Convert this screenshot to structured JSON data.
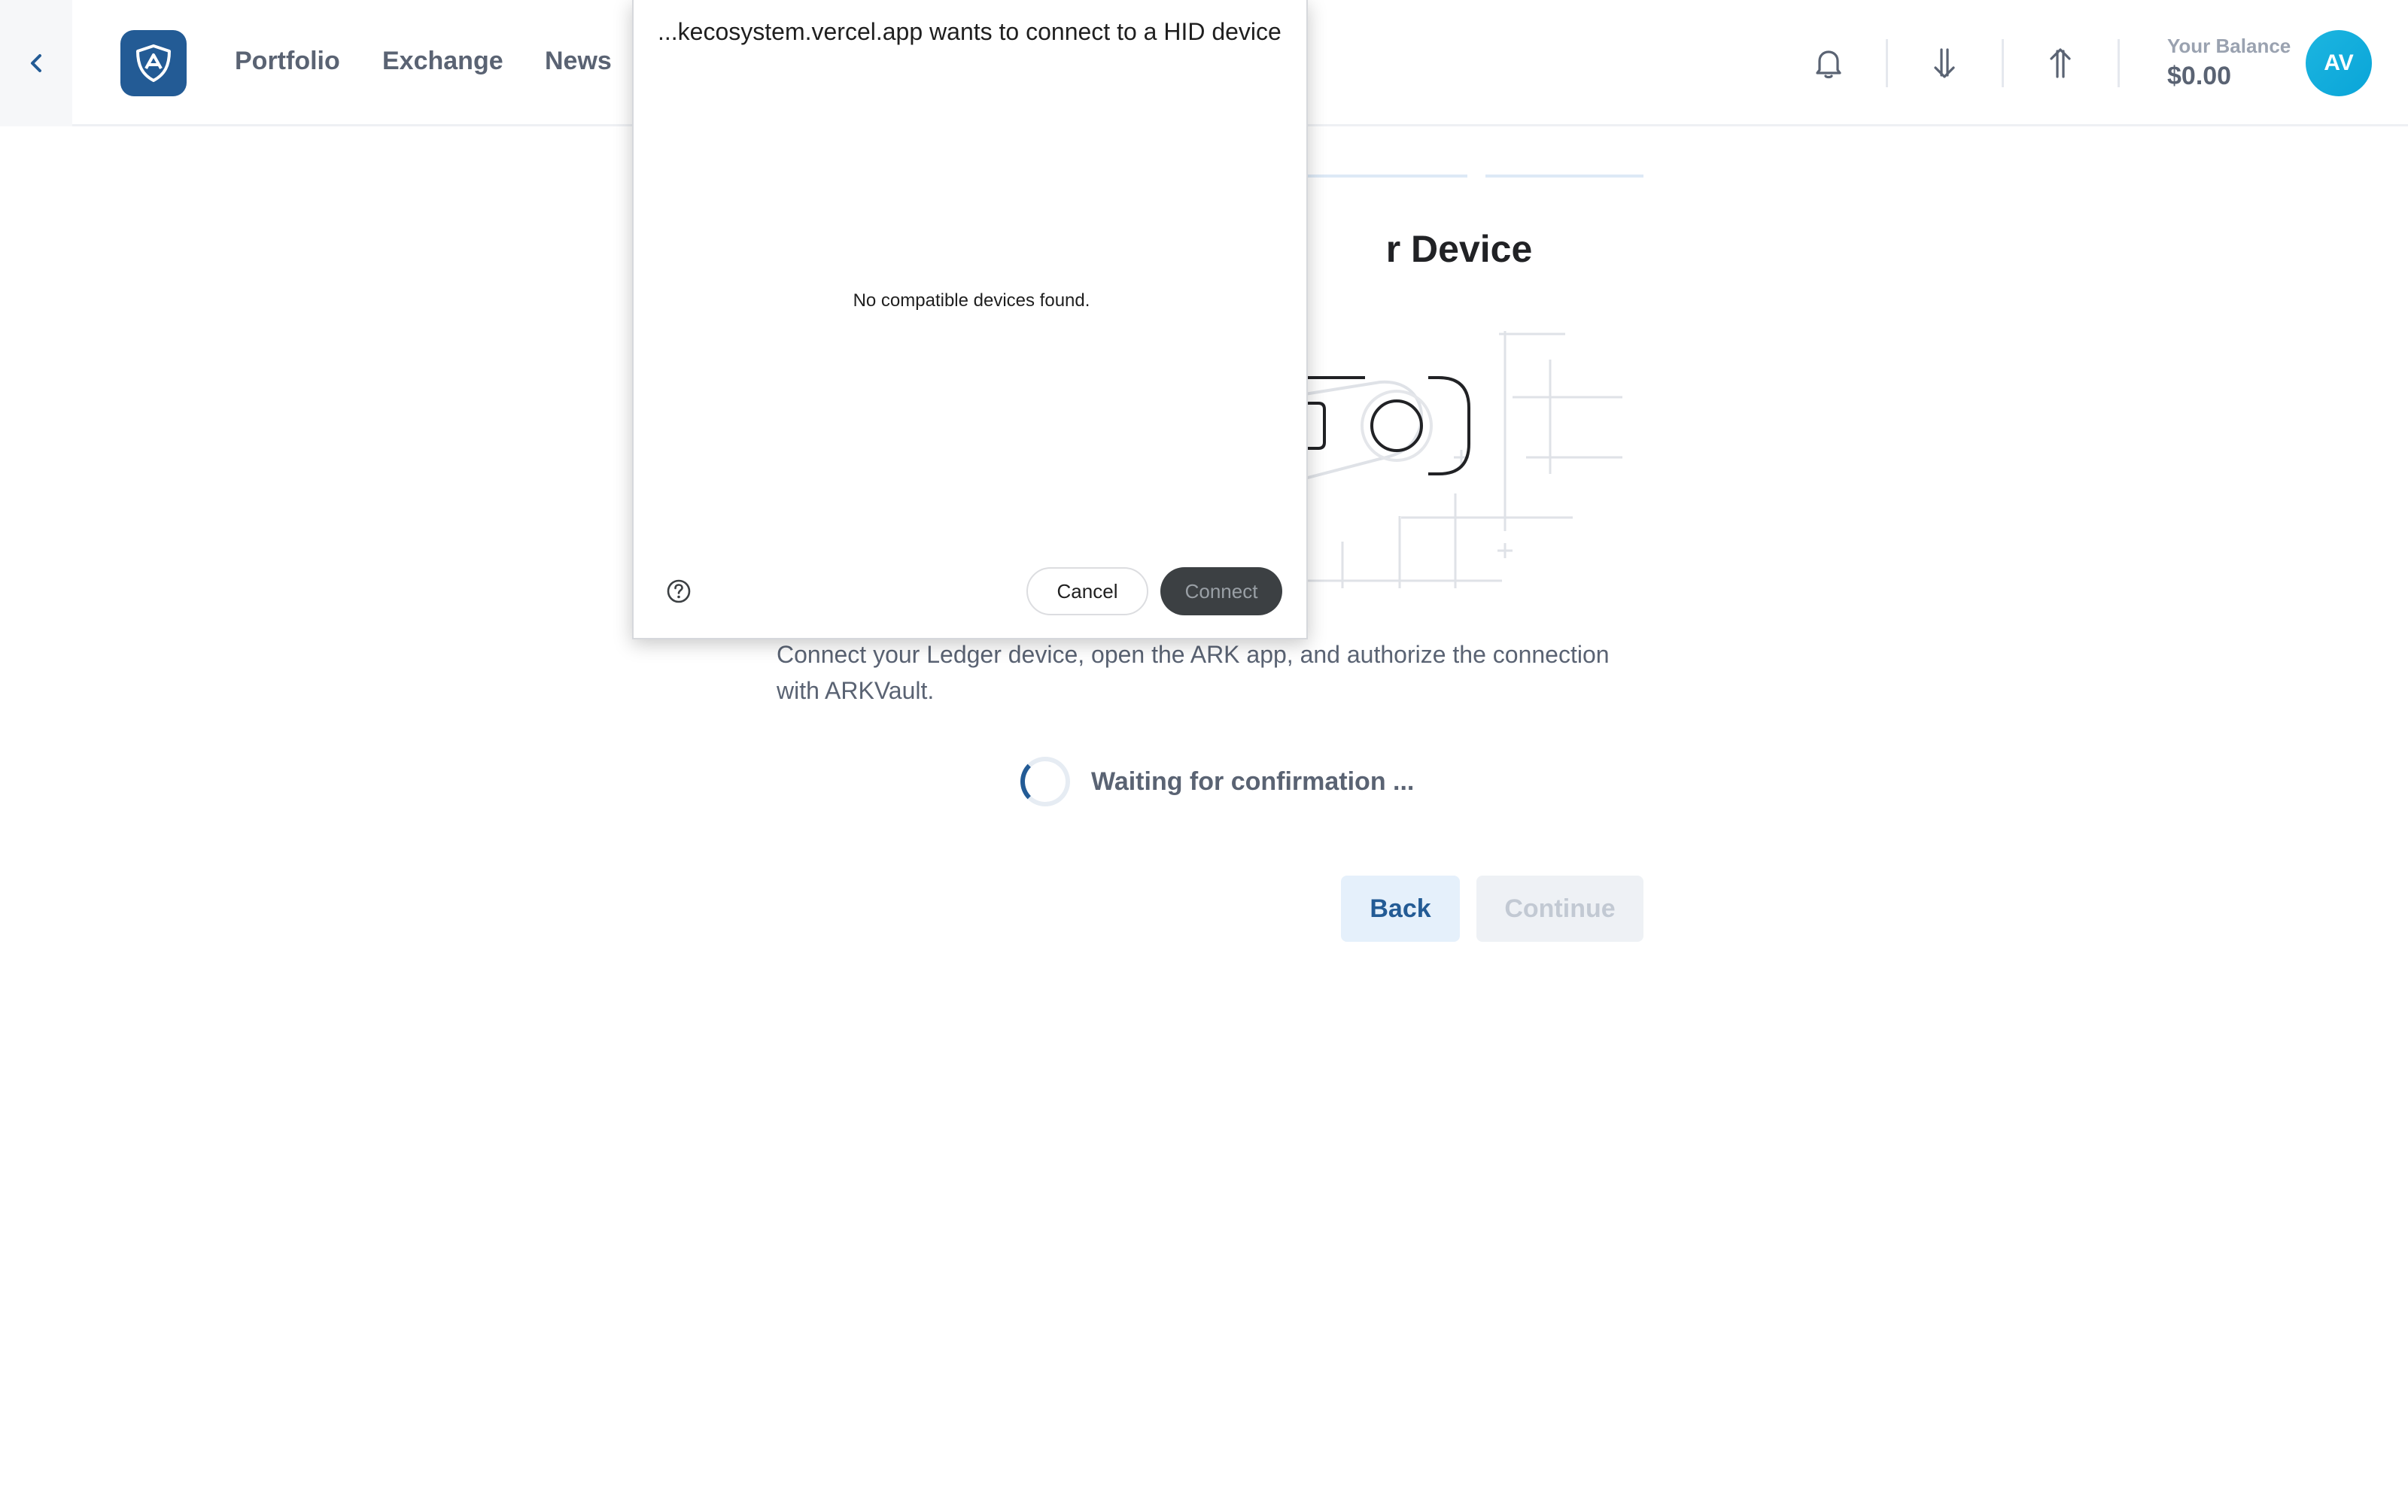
{
  "header": {
    "nav": {
      "portfolio": "Portfolio",
      "exchange": "Exchange",
      "news": "News"
    },
    "icons": [
      "chevron-left-icon",
      "ark-vault-logo",
      "bell-icon",
      "receive-arrow-icon",
      "send-arrow-icon"
    ],
    "balance": {
      "label": "Your Balance",
      "value": "$0.00"
    },
    "avatar_initials": "AV"
  },
  "main": {
    "title_visible": "r Device",
    "description": "Connect your Ledger device, open the ARK app, and authorize the connection with ARKVault.",
    "waiting": "Waiting for confirmation ...",
    "back_label": "Back",
    "continue_label": "Continue"
  },
  "dialog": {
    "title": "...kecosystem.vercel.app wants to connect to a HID device",
    "empty_message": "No compatible devices found.",
    "cancel_label": "Cancel",
    "connect_label": "Connect"
  },
  "colors": {
    "brand": "#235b95",
    "avatar": "#0aa5d8",
    "text_muted": "#5a6373"
  }
}
